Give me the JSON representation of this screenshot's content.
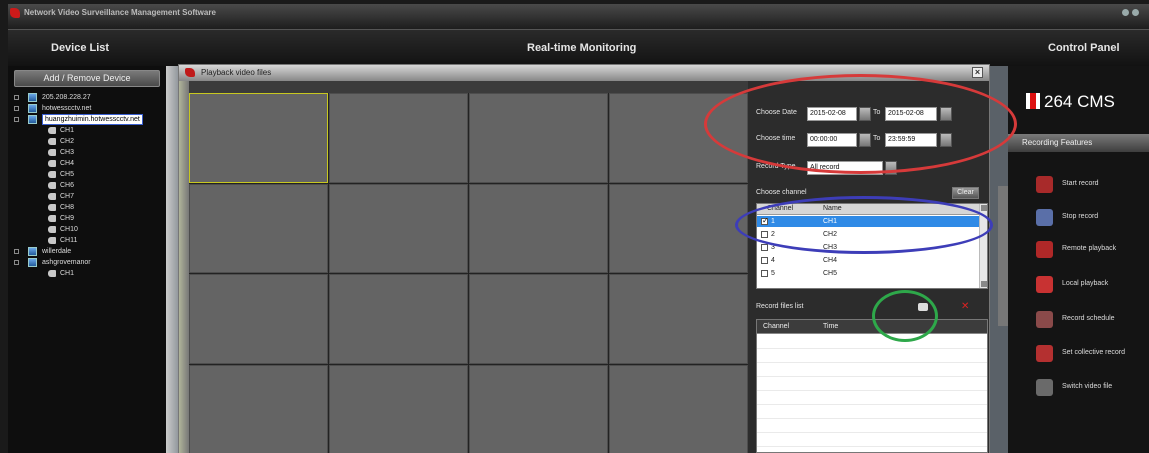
{
  "app": {
    "title": "Network Video Surveillance Management Software"
  },
  "header": {
    "device_list": "Device List",
    "realtime": "Real-time Monitoring",
    "control_panel": "Control Panel"
  },
  "left_panel": {
    "add_remove": "Add / Remove Device",
    "tree": [
      {
        "label": "205.208.228.27",
        "level": 0,
        "type": "device",
        "expand": "+"
      },
      {
        "label": "hotwesscctv.net",
        "level": 0,
        "type": "device",
        "expand": "+"
      },
      {
        "label": "huangzhuimin.hotwesscctv.net",
        "level": 0,
        "type": "device",
        "expand": "-",
        "selected": true
      },
      {
        "label": "CH1",
        "level": 1,
        "type": "camera"
      },
      {
        "label": "CH2",
        "level": 1,
        "type": "camera"
      },
      {
        "label": "CH3",
        "level": 1,
        "type": "camera"
      },
      {
        "label": "CH4",
        "level": 1,
        "type": "camera"
      },
      {
        "label": "CH5",
        "level": 1,
        "type": "camera"
      },
      {
        "label": "CH6",
        "level": 1,
        "type": "camera"
      },
      {
        "label": "CH7",
        "level": 1,
        "type": "camera"
      },
      {
        "label": "CH8",
        "level": 1,
        "type": "camera"
      },
      {
        "label": "CH9",
        "level": 1,
        "type": "camera"
      },
      {
        "label": "CH10",
        "level": 1,
        "type": "camera"
      },
      {
        "label": "CH11",
        "level": 1,
        "type": "camera"
      },
      {
        "label": "willerdale",
        "level": 0,
        "type": "device",
        "expand": "+"
      },
      {
        "label": "ashgrovemanor",
        "level": 0,
        "type": "device",
        "expand": "-"
      },
      {
        "label": "CH1",
        "level": 1,
        "type": "camera"
      }
    ]
  },
  "dialog": {
    "title": "Playback video files",
    "close": "×",
    "choose_date_label": "Choose Date",
    "date_from": "2015-02-08",
    "to_label": "To",
    "date_to": "2015-02-08",
    "choose_time_label": "Choose time",
    "time_from": "00:00:00",
    "time_to": "23:59:59",
    "record_type_label": "Record Type",
    "record_type_value": "All record",
    "choose_channel_label": "Choose channel",
    "clear_label": "Clear",
    "channel_columns": [
      "Channel",
      "Name"
    ],
    "channels": [
      {
        "num": "1",
        "name": "CH1",
        "checked": true,
        "selected": true
      },
      {
        "num": "2",
        "name": "CH2",
        "checked": false
      },
      {
        "num": "3",
        "name": "CH3",
        "checked": false
      },
      {
        "num": "4",
        "name": "CH4",
        "checked": false
      },
      {
        "num": "5",
        "name": "CH5",
        "checked": false
      }
    ],
    "record_list_label": "Record files list",
    "record_columns": [
      "Channel",
      "Time"
    ]
  },
  "right_panel": {
    "logo_text": "264 CMS",
    "recording_features": "Recording Features",
    "features": [
      {
        "label": "Start record",
        "icon": "start-record-icon",
        "color": "#a82a2a"
      },
      {
        "label": "Stop record",
        "icon": "stop-record-icon",
        "color": "#5a6fa8"
      },
      {
        "label": "Remote playback",
        "icon": "remote-playback-icon",
        "color": "#b02828"
      },
      {
        "label": "Local playback",
        "icon": "local-playback-icon",
        "color": "#c83232"
      },
      {
        "label": "Record schedule",
        "icon": "record-schedule-icon",
        "color": "#8a4a4a"
      },
      {
        "label": "Set collective record",
        "icon": "collective-record-icon",
        "color": "#b43030"
      },
      {
        "label": "Switch video file",
        "icon": "switch-video-icon",
        "color": "#6a6a6a"
      }
    ]
  },
  "colors": {
    "annotation_red": "#d63a3a",
    "annotation_blue": "#3d3db8",
    "annotation_green": "#2ea84a"
  }
}
